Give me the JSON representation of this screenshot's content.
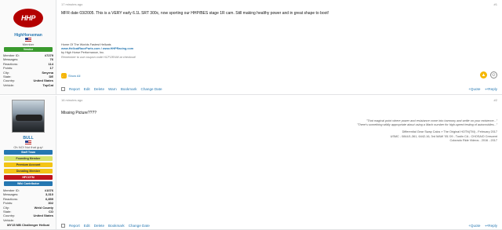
{
  "posts": [
    {
      "username": "HighHorseman",
      "user_title": "Member",
      "badge": "Vendor",
      "stats": [
        {
          "label": "Member ID:",
          "value": "#7279"
        },
        {
          "label": "Messages:",
          "value": "76"
        },
        {
          "label": "Reactions:",
          "value": "114"
        },
        {
          "label": "Points:",
          "value": "17"
        },
        {
          "label": "City:",
          "value": "Smyrna"
        },
        {
          "label": "State:",
          "value": "DE"
        },
        {
          "label": "Country:",
          "value": "United States"
        },
        {
          "label": "Vehicle:",
          "value": "TopCat"
        }
      ],
      "timestamp": "17 minutes ago",
      "post_number": "#1",
      "message": "MFR date 03/2005. This is a VERY early 6.1L SRT 300c, now sporting our HHP/BES stage 1R cam. Still making healthy power and in great shape to boot!",
      "signature_lines": [
        "Home Of The Worlds Fastest Hellcats",
        "www.HellcatRaceParts.com / www.HHPRacing.com",
        "by High Horse Performance, Inc.",
        "Remember to use coupon code HCFORUM at checkout!"
      ],
      "reactions_label": "Show All",
      "actions": [
        "Report",
        "Edit",
        "Delete",
        "Warn",
        "Bookmark",
        "Change Date"
      ],
      "right_actions": [
        "+Quote",
        "Reply"
      ]
    },
    {
      "username": "BULL",
      "user_title": "Oh NO! Not that guy!",
      "badges": [
        {
          "label": "Staff Team",
          "color": "#2577b1"
        },
        {
          "label": "Founding Member",
          "color": "#d7e36b"
        },
        {
          "label": "Premium Account",
          "color": "#f3c417"
        },
        {
          "label": "Donating Member",
          "color": "#f3c417"
        },
        {
          "label": "HFCOTM",
          "color": "#c0131b"
        },
        {
          "label": "Wiki Contributor",
          "color": "#2577b1"
        }
      ],
      "stats": [
        {
          "label": "Member ID:",
          "value": "#1076"
        },
        {
          "label": "Messages:",
          "value": "3,310"
        },
        {
          "label": "Reactions:",
          "value": "6,859"
        },
        {
          "label": "Points:",
          "value": "302"
        },
        {
          "label": "City:",
          "value": "Weld County"
        },
        {
          "label": "State:",
          "value": "CO"
        },
        {
          "label": "Country:",
          "value": "United States"
        },
        {
          "label": "Vehicle:",
          "value": ""
        }
      ],
      "vehicle_text": "MY15 MB Challenger Hellcat",
      "timestamp": "16 minutes ago",
      "post_number": "#2",
      "message": "Missing Picture????",
      "signature_right": [
        "\"That magical point where power and resistance come into harmony and settle on your existence...\"",
        "\"There's something wildly appropriate about using a Mach number for high-speed testing of automobiles...\"",
        "Differential Gear Swap Calcs » The Original HOTN(TM) - February 2017",
        "USMC - 0844/1-361, 6442-16, 3rd MAW '05-'09 - Tustin CA - CHOSA/D Crescent",
        "Colorado Ride Videos - 2016 - 2017"
      ],
      "actions": [
        "Report",
        "Edit",
        "Delete",
        "Bookmark",
        "Change Date"
      ],
      "right_actions": [
        "+Quote",
        "Reply"
      ]
    }
  ],
  "icons": {
    "like": "thumbs-up-icon",
    "smile": "smiley-icon"
  }
}
